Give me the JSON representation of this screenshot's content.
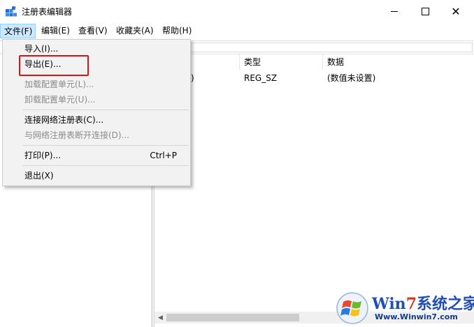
{
  "window": {
    "title": "注册表编辑器",
    "controls": {
      "minimize": "minimize-icon",
      "maximize": "maximize-icon",
      "close": "close-icon"
    },
    "close_glyph": "✕"
  },
  "menubar": {
    "items": [
      "文件(F)",
      "编辑(E)",
      "查看(V)",
      "收藏夹(A)",
      "帮助(H)"
    ],
    "active_index": 0
  },
  "file_menu": {
    "items": [
      {
        "label": "导入(I)...",
        "enabled": true,
        "shortcut": ""
      },
      {
        "label": "导出(E)...",
        "enabled": true,
        "shortcut": "",
        "highlighted": true
      },
      {
        "label": "加载配置单元(L)...",
        "enabled": false,
        "shortcut": ""
      },
      {
        "label": "卸载配置单元(U)...",
        "enabled": false,
        "shortcut": ""
      },
      {
        "label": "连接网络注册表(C)...",
        "enabled": true,
        "shortcut": ""
      },
      {
        "label": "与网络注册表断开连接(D)...",
        "enabled": false,
        "shortcut": ""
      },
      {
        "label": "打印(P)...",
        "enabled": true,
        "shortcut": "Ctrl+P"
      },
      {
        "label": "退出(X)",
        "enabled": true,
        "shortcut": ""
      }
    ]
  },
  "values_list": {
    "columns": [
      "类型",
      "数据"
    ],
    "rows": [
      {
        "name_fragment": ")",
        "type": "REG_SZ",
        "data": "(数值未设置)"
      }
    ]
  },
  "scrollbar": {
    "left_arrow": "◀",
    "right_arrow": "▶"
  },
  "watermark": {
    "name_prefix": "Win",
    "name_seven": "7",
    "name_suffix": "系统之家",
    "url": "Www.Winwin7.com",
    "colors": {
      "blue": "#1f4fb5",
      "red": "#e0301e"
    }
  },
  "colors": {
    "menu_active_bg": "#cce8ff",
    "menu_bg": "#f2f2f2",
    "highlight_border": "#d8141b",
    "disabled_text": "#8a8a8a"
  }
}
